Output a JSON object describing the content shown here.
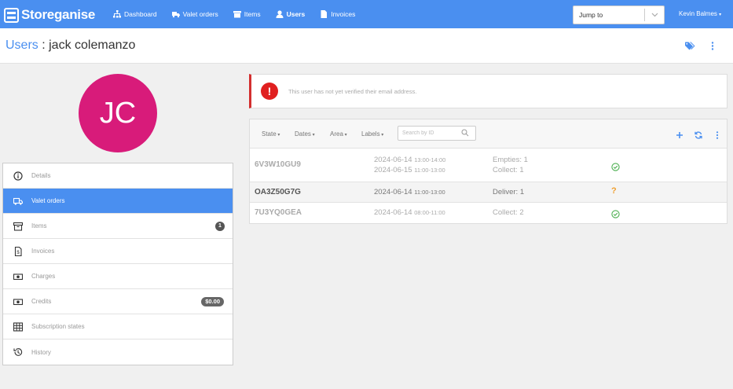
{
  "brand": {
    "name": "Storeganise"
  },
  "nav": {
    "items": [
      {
        "label": "Dashboard",
        "icon": "sitemap-icon"
      },
      {
        "label": "Valet orders",
        "icon": "truck-icon"
      },
      {
        "label": "Items",
        "icon": "archive-icon"
      },
      {
        "label": "Users",
        "icon": "user-icon",
        "active": true
      },
      {
        "label": "Invoices",
        "icon": "file-icon"
      }
    ],
    "jump_to": "Jump to",
    "user_name": "Kevin Balmes"
  },
  "header": {
    "breadcrumb": "Users",
    "separator": " : ",
    "title": "jack colemanzo"
  },
  "profile": {
    "initials": "JC",
    "avatar_color": "#d81b7a"
  },
  "sidebar": {
    "items": [
      {
        "label": "Details",
        "icon": "info-circle-icon"
      },
      {
        "label": "Valet orders",
        "icon": "truck-icon",
        "active": true
      },
      {
        "label": "Items",
        "icon": "archive-icon",
        "badge": "1"
      },
      {
        "label": "Invoices",
        "icon": "invoice-icon"
      },
      {
        "label": "Charges",
        "icon": "money-icon"
      },
      {
        "label": "Credits",
        "icon": "money-icon",
        "badge": "$0.00"
      },
      {
        "label": "Subscription states",
        "icon": "table-icon"
      },
      {
        "label": "History",
        "icon": "history-icon"
      }
    ]
  },
  "alert": {
    "message": "This user has not yet verified their email address.",
    "icon": "exclamation-icon"
  },
  "orders": {
    "filters": [
      "State",
      "Dates",
      "Area",
      "Labels"
    ],
    "search_placeholder": "Search by ID",
    "rows": [
      {
        "id": "6V3W10GU9",
        "dates": [
          {
            "date": "2024-06-14",
            "time": "13:00-14:00"
          },
          {
            "date": "2024-06-15",
            "time": "11:00-13:00"
          }
        ],
        "actions": [
          "Empties: 1",
          "Collect: 1"
        ],
        "status_icon": "check-circle-icon"
      },
      {
        "id": "OA3Z50G7G",
        "dates": [
          {
            "date": "2024-06-14",
            "time": "11:00-13:00"
          }
        ],
        "actions": [
          "Deliver: 1"
        ],
        "status_icon": "question-icon",
        "status_text": "?"
      },
      {
        "id": "7U3YQ0GEA",
        "dates": [
          {
            "date": "2024-06-14",
            "time": "08:00-11:00"
          }
        ],
        "actions": [
          "Collect: 2"
        ],
        "status_icon": "check-circle-icon"
      }
    ]
  },
  "colors": {
    "primary": "#4a8ff0",
    "danger": "#e02020",
    "success": "#4caf50",
    "warning": "#f0a030"
  }
}
